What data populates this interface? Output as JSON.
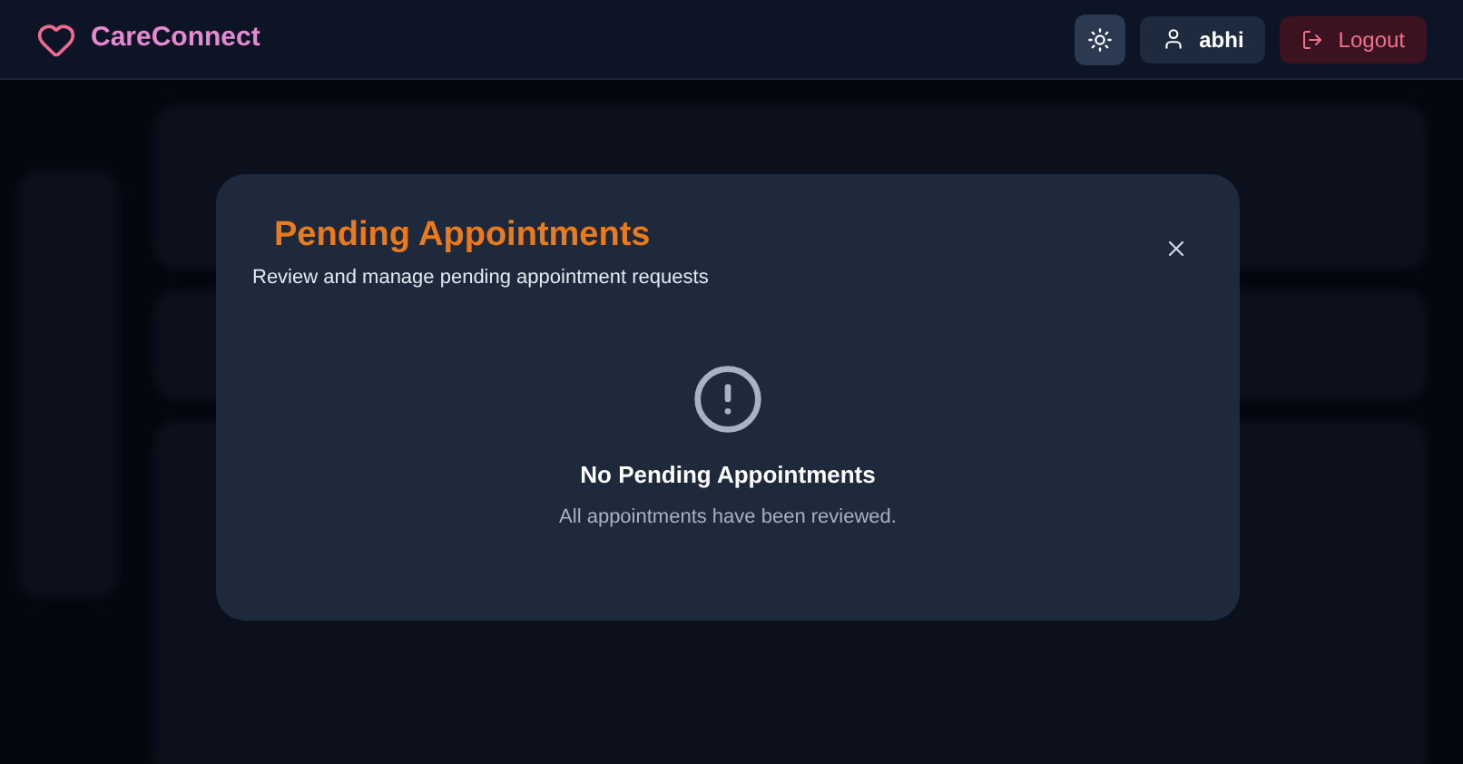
{
  "header": {
    "brand": "CareConnect",
    "user": "abhi",
    "logout": "Logout"
  },
  "modal": {
    "title": "Pending Appointments",
    "subtitle": "Review and manage pending appointment requests",
    "empty_title": "No Pending Appointments",
    "empty_text": "All appointments have been reviewed."
  }
}
